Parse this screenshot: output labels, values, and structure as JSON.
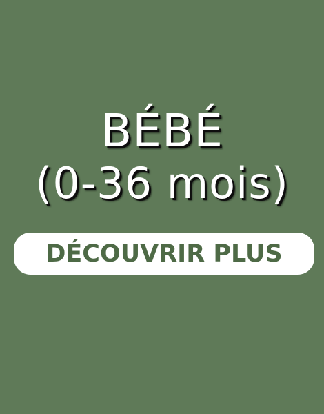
{
  "banner": {
    "title_line1": "BÉBÉ",
    "title_line2": "(0-36 mois)",
    "cta_label": "DÉCOUVRIR PLUS"
  },
  "colors": {
    "background": "#5f7a58",
    "title_text": "#ffffff",
    "title_shadow": "#0e0e0e",
    "button_bg": "#ffffff",
    "button_text": "#4e6a46"
  }
}
